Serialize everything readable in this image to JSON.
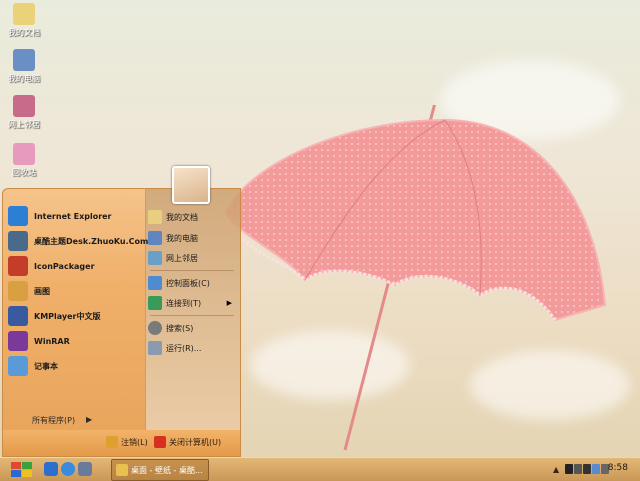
{
  "desktop_icons": [
    {
      "label": "我的文档",
      "icon": "folder-icon",
      "color": "#e9d27a"
    },
    {
      "label": "我的电脑",
      "icon": "computer-icon",
      "color": "#6a8fc4"
    },
    {
      "label": "网上邻居",
      "icon": "network-icon",
      "color": "#c86a8a"
    },
    {
      "label": "回收站",
      "icon": "recycle-bin-icon",
      "color": "#e89abd"
    }
  ],
  "start_menu": {
    "programs": [
      {
        "label": "Internet Explorer",
        "icon": "ie-icon",
        "color": "#2d7fd6"
      },
      {
        "label": "桌酷主题Desk.ZhuoKu.Com",
        "icon": "zhuoku-icon",
        "color": "#4a6a8a"
      },
      {
        "label": "IconPackager",
        "icon": "iconpackager-icon",
        "color": "#c43c2a"
      },
      {
        "label": "画图",
        "icon": "paint-icon",
        "color": "#d8a040"
      },
      {
        "label": "KMPlayer中文版",
        "icon": "kmplayer-icon",
        "color": "#3a5aa0"
      },
      {
        "label": "WinRAR",
        "icon": "winrar-icon",
        "color": "#7a3a9a"
      },
      {
        "label": "记事本",
        "icon": "notepad-icon",
        "color": "#5a9ad8"
      }
    ],
    "all_programs": "所有程序(P)",
    "places": [
      {
        "label": "我的文档",
        "icon": "my-documents-icon",
        "color": "#e8cf80"
      },
      {
        "label": "我的电脑",
        "icon": "my-computer-icon",
        "color": "#5f86bf"
      },
      {
        "label": "网上邻居",
        "icon": "network-places-icon",
        "color": "#6aa0c8"
      }
    ],
    "system": [
      {
        "label": "控制面板(C)",
        "icon": "control-panel-icon",
        "color": "#4f8bd0"
      },
      {
        "label": "连接到(T)",
        "icon": "connect-to-icon",
        "color": "#3a9a5a"
      },
      {
        "label": "搜索(S)",
        "icon": "search-icon",
        "color": "#7a7a7a"
      },
      {
        "label": "运行(R)...",
        "icon": "run-icon",
        "color": "#8a9ab0"
      }
    ],
    "logoff_label": "注销(L)",
    "shutdown_label": "关闭计算机(U)"
  },
  "taskbar": {
    "task_label": "桌面 - 壁纸 - 桌酷...",
    "clock": "8:58"
  },
  "colors": {
    "menu_left": "#f0b06a",
    "taskbar": "#d7a765"
  }
}
